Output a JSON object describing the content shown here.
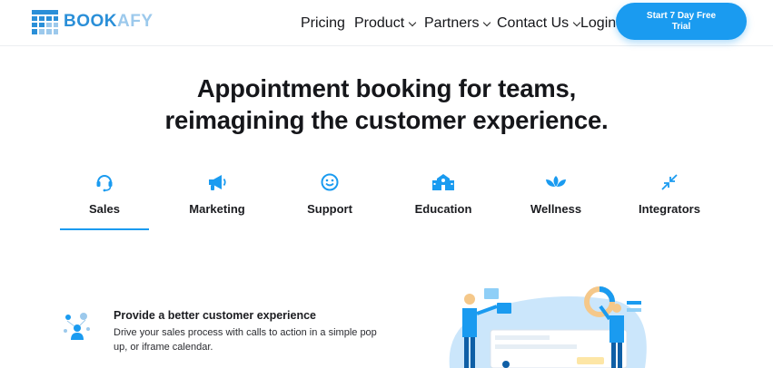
{
  "brand": {
    "name_part1": "BOOK",
    "name_part2": "AFY",
    "primary": "#2a8fd8",
    "accent": "#1a9bf0"
  },
  "nav": {
    "items": [
      {
        "label": "Pricing",
        "dropdown": false
      },
      {
        "label": "Product",
        "dropdown": true
      },
      {
        "label": "Partners",
        "dropdown": true
      },
      {
        "label": "Contact Us",
        "dropdown": true
      },
      {
        "label": "Login",
        "dropdown": false
      }
    ],
    "cta_label": "Start 7 Day Free Trial"
  },
  "hero": {
    "line1": "Appointment booking for teams,",
    "line2": "reimagining the customer experience."
  },
  "tabs": [
    {
      "label": "Sales",
      "icon": "headset-icon",
      "active": true
    },
    {
      "label": "Marketing",
      "icon": "megaphone-icon",
      "active": false
    },
    {
      "label": "Support",
      "icon": "smiley-icon",
      "active": false
    },
    {
      "label": "Education",
      "icon": "school-icon",
      "active": false
    },
    {
      "label": "Wellness",
      "icon": "lotus-icon",
      "active": false
    },
    {
      "label": "Integrators",
      "icon": "arrows-in-icon",
      "active": false
    }
  ],
  "feature": {
    "icon": "sales-people-icon",
    "title": "Provide a better customer experience",
    "body": "Drive your sales process with calls to action in a simple pop up, or iframe calendar."
  }
}
